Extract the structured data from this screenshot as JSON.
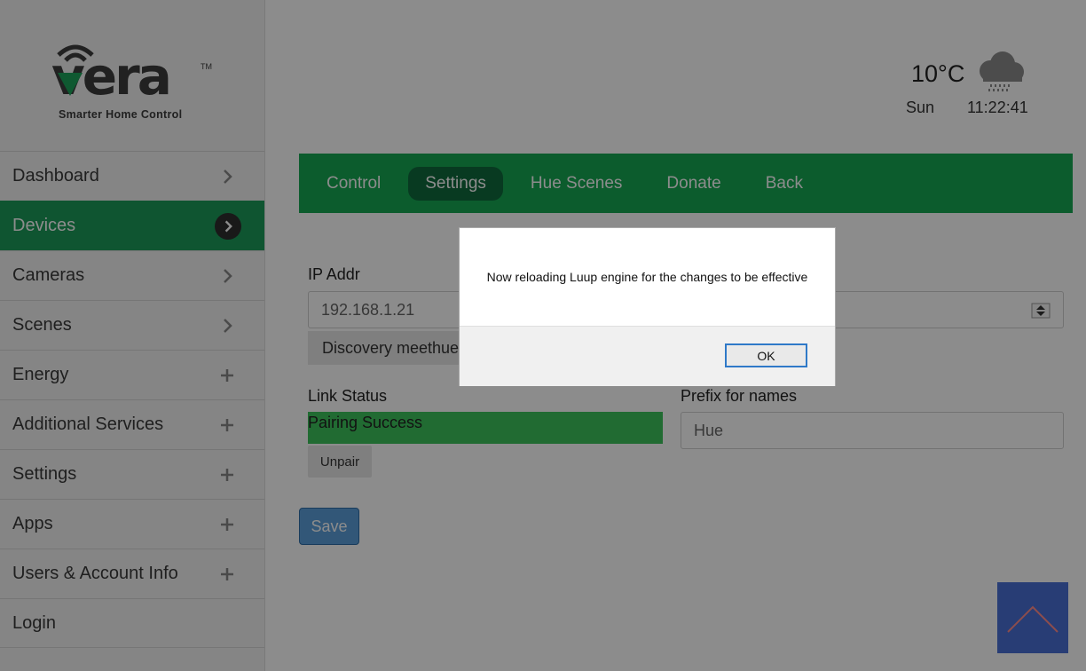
{
  "logo": {
    "word": "vera",
    "tm": "TM",
    "tagline": "Smarter Home Control"
  },
  "sidebar": {
    "items": [
      {
        "label": "Dashboard",
        "icon": "chevron-right-icon",
        "active": false
      },
      {
        "label": "Devices",
        "icon": "chevron-right-circle-icon",
        "active": true
      },
      {
        "label": "Cameras",
        "icon": "chevron-right-icon",
        "active": false
      },
      {
        "label": "Scenes",
        "icon": "chevron-right-icon",
        "active": false
      },
      {
        "label": "Energy",
        "icon": "plus-icon",
        "active": false
      },
      {
        "label": "Additional Services",
        "icon": "plus-icon",
        "active": false
      },
      {
        "label": "Settings",
        "icon": "plus-icon",
        "active": false
      },
      {
        "label": "Apps",
        "icon": "plus-icon",
        "active": false
      },
      {
        "label": "Users & Account Info",
        "icon": "plus-icon",
        "active": false
      },
      {
        "label": "Login",
        "icon": "",
        "active": false
      }
    ]
  },
  "header": {
    "temperature": "10°C",
    "weather_icon": "rain-cloud-icon",
    "day": "Sun",
    "time": "11:22:41"
  },
  "tabs": [
    {
      "label": "Control",
      "active": false
    },
    {
      "label": "Settings",
      "active": true
    },
    {
      "label": "Hue Scenes",
      "active": false
    },
    {
      "label": "Donate",
      "active": false
    },
    {
      "label": "Back",
      "active": false
    }
  ],
  "form": {
    "ip_label": "IP Addr",
    "ip_value": "192.168.1.21",
    "discovery_label": "Discovery meethue.com",
    "link_status_label": "Link Status",
    "pairing_status": "Pairing Success",
    "unpair_label": "Unpair",
    "prefix_label": "Prefix for names",
    "prefix_value": "Hue",
    "save_label": "Save"
  },
  "dialog": {
    "message": "Now reloading Luup engine for the changes to be effective",
    "ok_label": "OK"
  },
  "colors": {
    "accent_green": "#16a853",
    "active_tab": "#0f6b3d",
    "pairing_green": "#3dc35c",
    "save_blue": "#5b9edb",
    "scroll_top_blue": "#4a6fd6"
  }
}
